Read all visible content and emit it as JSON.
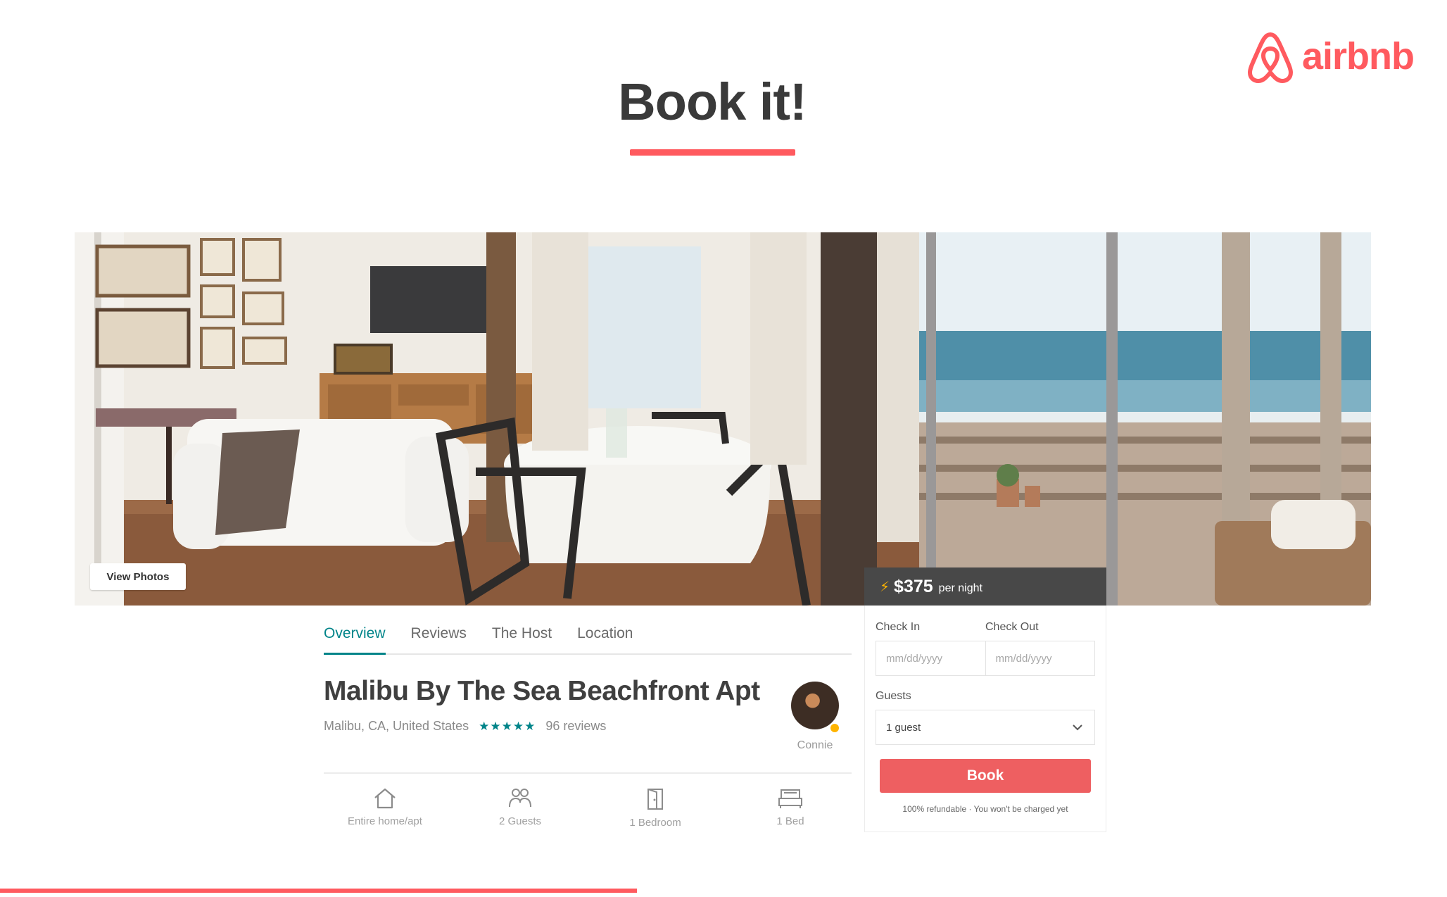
{
  "brand": {
    "name": "airbnb",
    "color": "#ff5a5f",
    "icon": "airbnb-belo-icon"
  },
  "slide": {
    "title": "Book it!"
  },
  "hero": {
    "view_photos_label": "View Photos"
  },
  "tabs": [
    {
      "label": "Overview",
      "active": true
    },
    {
      "label": "Reviews",
      "active": false
    },
    {
      "label": "The Host",
      "active": false
    },
    {
      "label": "Location",
      "active": false
    }
  ],
  "listing": {
    "title": "Malibu By The Sea Beachfront Apt",
    "location": "Malibu, CA, United States",
    "rating_stars": "★★★★★",
    "rating": 5,
    "reviews": "96 reviews",
    "host_name": "Connie"
  },
  "amenities": [
    {
      "icon": "home-icon",
      "label": "Entire home/apt"
    },
    {
      "icon": "guests-icon",
      "label": "2 Guests"
    },
    {
      "icon": "door-icon",
      "label": "1 Bedroom"
    },
    {
      "icon": "bed-icon",
      "label": "1 Bed"
    }
  ],
  "booking": {
    "price": "$375",
    "per_night": "per night",
    "check_in_label": "Check In",
    "check_out_label": "Check Out",
    "check_in_placeholder": "mm/dd/yyyy",
    "check_out_placeholder": "mm/dd/yyyy",
    "guests_label": "Guests",
    "guests_value": "1 guest",
    "book_label": "Book",
    "fine_print": "100% refundable · You won't be charged yet"
  },
  "progress": {
    "fraction": 0.44
  },
  "colors": {
    "accent": "#ff5a5f",
    "teal": "#008489",
    "dark_bar": "#484848",
    "star_highlight": "#ffb400"
  }
}
